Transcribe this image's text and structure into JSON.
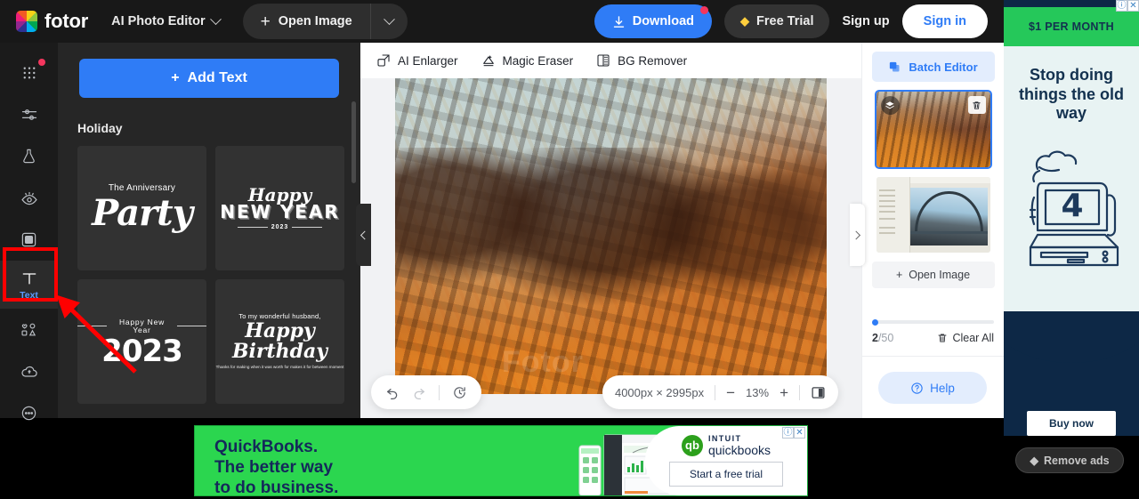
{
  "header": {
    "logo_text": "fotor",
    "mode_label": "AI Photo Editor",
    "open_image_label": "Open Image",
    "download_label": "Download",
    "free_trial_label": "Free Trial",
    "sign_up_label": "Sign up",
    "sign_in_label": "Sign in",
    "accent_blue": "#2f7cf6",
    "notify_dot_color": "#f4365e"
  },
  "rail": {
    "items": [
      {
        "name": "templates",
        "icon": "grid-dots-icon",
        "label": ""
      },
      {
        "name": "adjust",
        "icon": "sliders-icon",
        "label": ""
      },
      {
        "name": "beauty",
        "icon": "flask-icon",
        "label": ""
      },
      {
        "name": "effects",
        "icon": "eye-icon",
        "label": ""
      },
      {
        "name": "frame",
        "icon": "square-frame-icon",
        "label": ""
      },
      {
        "name": "text",
        "icon": "text-t-icon",
        "label": "Text"
      },
      {
        "name": "elements",
        "icon": "shapes-icon",
        "label": ""
      },
      {
        "name": "background",
        "icon": "cloud-icon",
        "label": ""
      },
      {
        "name": "more",
        "icon": "more-dots-circle-icon",
        "label": ""
      }
    ],
    "active": "text",
    "highlight_color": "#ff0000"
  },
  "panel": {
    "add_text_label": "Add Text",
    "section_title": "Holiday",
    "templates": [
      {
        "id": "anniversary-party",
        "line1": "The Anniversary",
        "line2": "Party"
      },
      {
        "id": "happy-new-year",
        "line1": "Happy",
        "line2": "NEW YEAR",
        "line3": "2023"
      },
      {
        "id": "new-year-2023",
        "line1": "Happy New Year",
        "line2": "2023"
      },
      {
        "id": "happy-birthday",
        "line1": "To my wonderful husband,",
        "line2": "Happy Birthday",
        "line3": "Thanks for making when it was worth for makes it for between moment"
      }
    ]
  },
  "editor": {
    "tools": [
      {
        "id": "ai-enlarger",
        "label": "AI Enlarger",
        "icon": "enlarge-icon"
      },
      {
        "id": "magic-eraser",
        "label": "Magic Eraser",
        "icon": "eraser-icon"
      },
      {
        "id": "bg-remover",
        "label": "BG Remover",
        "icon": "bg-remove-icon"
      }
    ],
    "watermark": "Fotor",
    "bottom_bar": {
      "undo_icon": "undo-arrow-icon",
      "redo_icon": "redo-arrow-icon",
      "history_icon": "history-clock-icon",
      "dimensions": "4000px × 2995px",
      "zoom_out_label": "−",
      "zoom_level": "13%",
      "zoom_in_label": "+",
      "compare_icon": "compare-split-icon"
    }
  },
  "right_panel": {
    "batch_editor_label": "Batch Editor",
    "thumbnails": [
      {
        "id": "thumb-desert-canyon",
        "selected": true
      },
      {
        "id": "thumb-bridge-screenshot",
        "selected": false
      }
    ],
    "open_image_label": "Open Image",
    "count_current": "2",
    "count_total": "/50",
    "clear_all_label": "Clear All",
    "help_label": "Help"
  },
  "ads": {
    "right": {
      "banner_label": "$1 PER MONTH",
      "headline": "Stop doing things the old way",
      "art_number": "4",
      "cta_label": "Buy now",
      "info_icon": "ad-info-icon",
      "close_icon": "ad-close-icon"
    },
    "bottom": {
      "headline_line1": "QuickBooks.",
      "headline_line2": "The better way",
      "headline_line3": "to do business.",
      "brand_mark": "qb",
      "brand_top": "INTUIT",
      "brand_name": "quickbooks",
      "cta_label": "Start a free trial",
      "info_icon": "ad-info-icon",
      "close_icon": "ad-close-icon"
    }
  },
  "remove_ads": {
    "label": "Remove ads",
    "icon": "gem-icon"
  }
}
